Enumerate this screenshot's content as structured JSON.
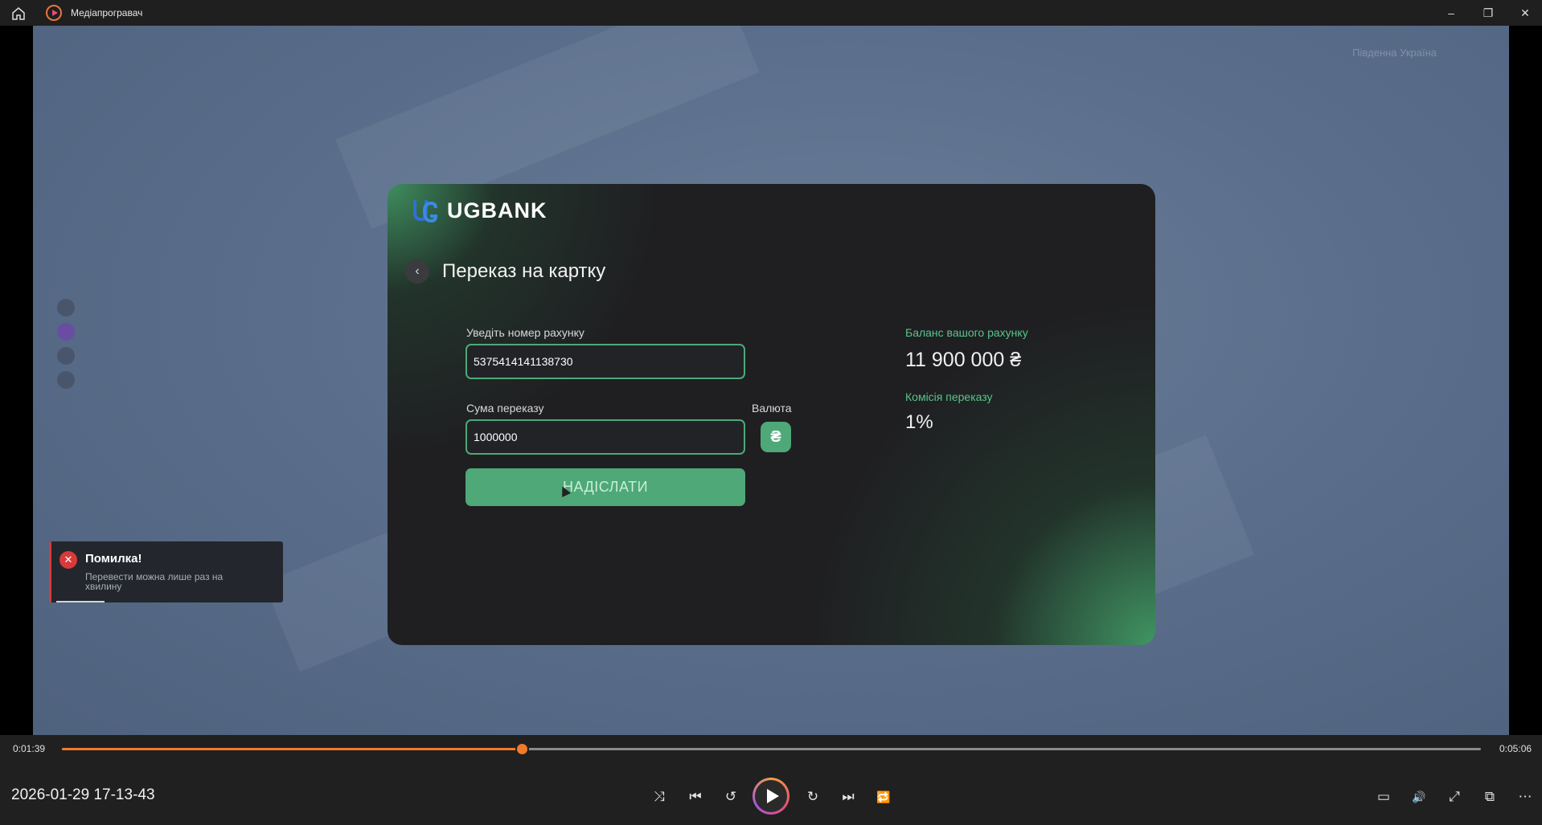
{
  "window": {
    "title": "Медіапрогравач",
    "minimize": "–",
    "restore": "❐",
    "close": "✕"
  },
  "hud": {
    "region": "Південна Україна"
  },
  "bank": {
    "name": "UGBANK",
    "page_title": "Переказ на картку",
    "account_label": "Уведіть номер рахунку",
    "account_value": "5375414141138730",
    "amount_label": "Сума переказу",
    "amount_value": "1000000",
    "currency_label": "Валюта",
    "currency_symbol": "₴",
    "send_label": "НАДІСЛАТИ",
    "balance_label": "Баланс вашого рахунку",
    "balance_value": "11 900 000 ₴",
    "fee_label": "Комісія переказу",
    "fee_value": "1%",
    "accent_color": "#4ea878"
  },
  "toast": {
    "title": "Помилка!",
    "message": "Перевести можна лише раз на хвилину"
  },
  "player": {
    "elapsed": "0:01:39",
    "total": "0:05:06",
    "progress_fraction": 0.324,
    "date_label": "2026-01-29 17-13-43",
    "accent_color": "#f07a2a",
    "icons": {
      "shuffle": "⤨",
      "previous": "⏮",
      "rewind": "↺",
      "forward": "↻",
      "next": "⏭",
      "repeat": "🔁",
      "subtitles": "▭",
      "volume": "🔊",
      "fullscreen": "⤢",
      "miniplayer": "⧉",
      "more": "⋯"
    }
  }
}
